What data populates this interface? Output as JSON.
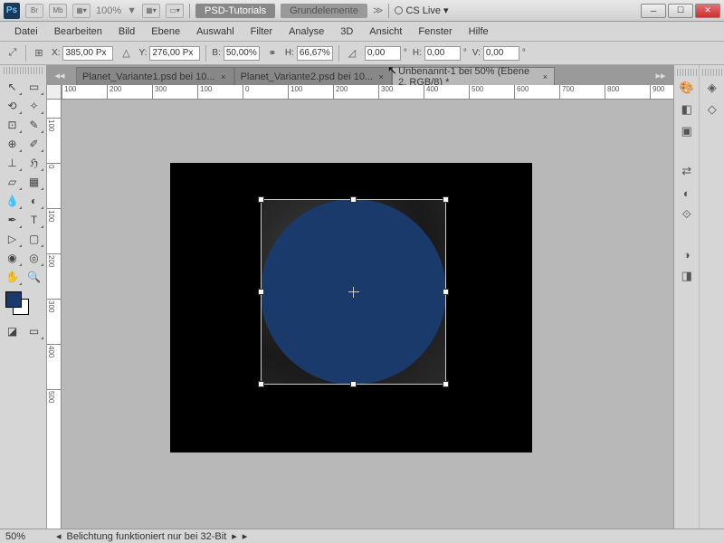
{
  "titlebar": {
    "zoom": "100%",
    "buttons": {
      "br": "Br",
      "mb": "Mb"
    },
    "links": {
      "psd": "PSD-Tutorials",
      "grund": "Grundelemente"
    },
    "cslive": "CS Live"
  },
  "menu": [
    "Datei",
    "Bearbeiten",
    "Bild",
    "Ebene",
    "Auswahl",
    "Filter",
    "Analyse",
    "3D",
    "Ansicht",
    "Fenster",
    "Hilfe"
  ],
  "options": {
    "x_label": "X:",
    "x": "385,00 Px",
    "y_label": "Y:",
    "y": "276,00 Px",
    "b_label": "B:",
    "b": "50,00%",
    "h_label": "H:",
    "h": "66,67%",
    "ang_label": "",
    "ang": "0,00",
    "h2_label": "H:",
    "h2": "0,00",
    "v_label": "V:",
    "v": "0,00",
    "deg": "°"
  },
  "tabs": [
    {
      "label": "Planet_Variante1.psd bei 10...",
      "active": false
    },
    {
      "label": "Planet_Variante2.psd bei 10...",
      "active": false
    },
    {
      "label": "Unbenannt-1 bei 50% (Ebene 2, RGB/8) *",
      "active": true
    }
  ],
  "ruler_h": [
    "100",
    "200",
    "300",
    "100",
    "0",
    "100",
    "200",
    "300",
    "400",
    "500",
    "600",
    "700",
    "800",
    "900",
    "100"
  ],
  "ruler_v": [
    "100",
    "0",
    "100",
    "200",
    "300",
    "400",
    "500"
  ],
  "status": {
    "zoom": "50%",
    "msg": "Belichtung funktioniert nur bei 32-Bit"
  },
  "colors": {
    "fg": "#1a3a6b",
    "bg": "#ffffff"
  }
}
